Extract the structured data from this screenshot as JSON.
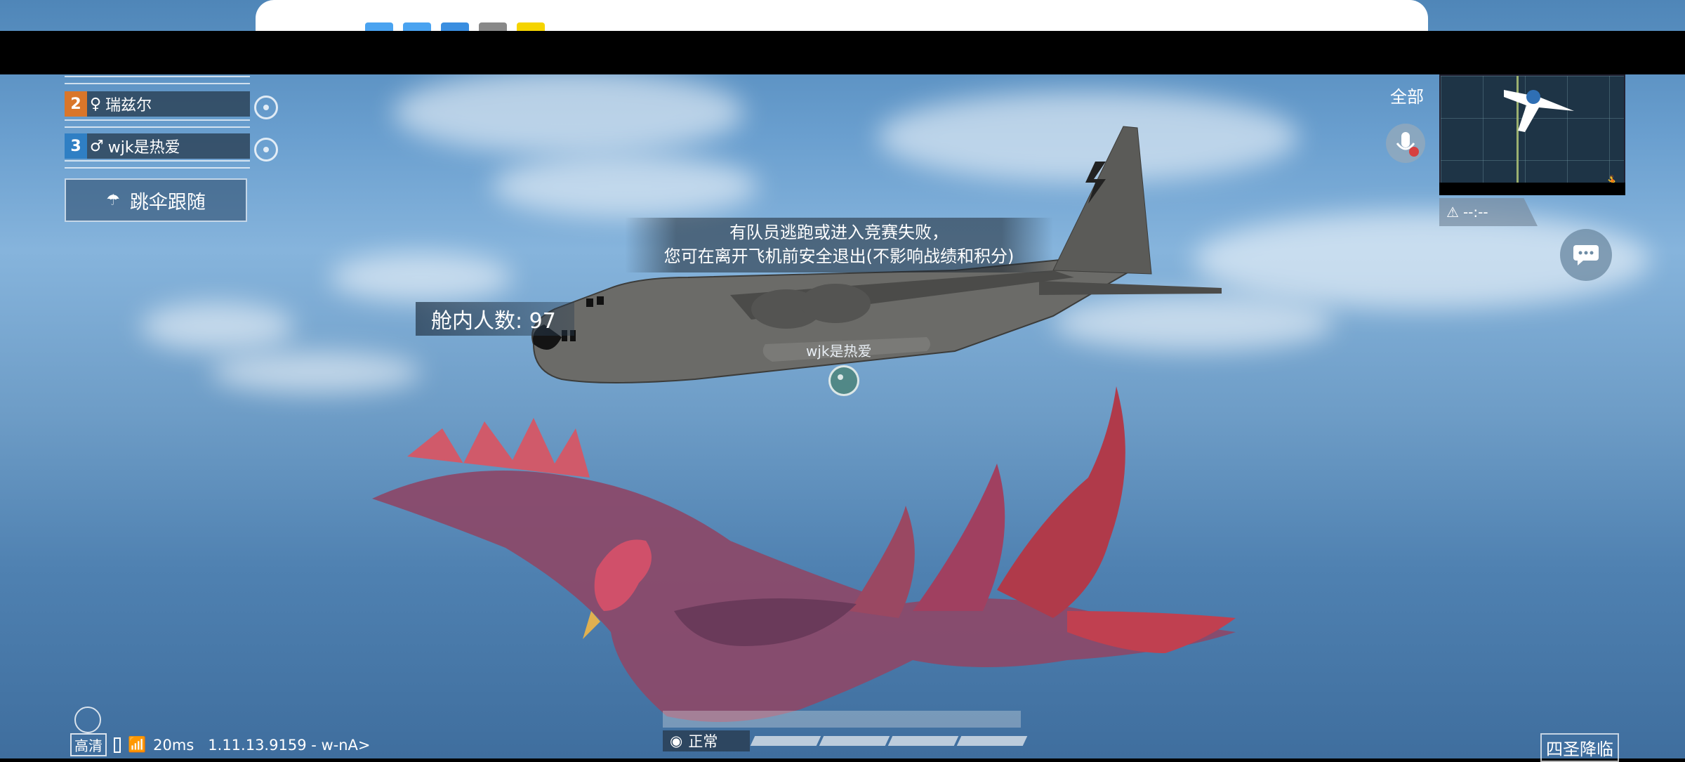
{
  "team": {
    "members": [
      {
        "number": "2",
        "gender_icon": "♀",
        "name": "瑞兹尔",
        "number_color": "#d9762a"
      },
      {
        "number": "3",
        "gender_icon": "♂",
        "name": "wjk是热爱",
        "number_color": "#2f7fc4"
      }
    ],
    "parachute_follow": "跳伞跟随"
  },
  "notice": {
    "line1": "有队员逃跑或进入竞赛失败，",
    "line2": "您可在离开飞机前安全退出(不影响战绩和积分)"
  },
  "cabin_count": "舱内人数: 97",
  "plane_label": "wjk是热爱",
  "voice": {
    "all_label": "全部"
  },
  "minimap": {
    "warning_time": "--:--"
  },
  "bottom": {
    "quality": "高清",
    "ping": "20ms",
    "version": "1.11.13.9159 - w-nA>",
    "status": "正常",
    "mode": "四圣降临"
  },
  "colors": {
    "sky": "#6a9fcf",
    "panel": "#28405a"
  }
}
